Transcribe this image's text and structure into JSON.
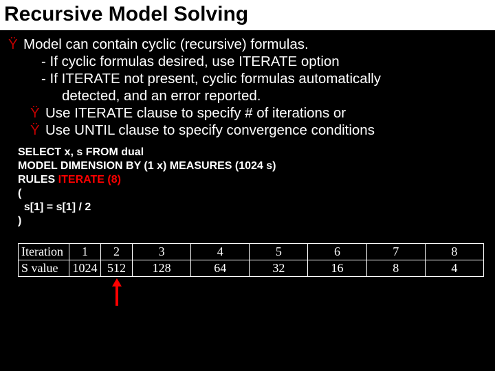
{
  "title": "Recursive Model Solving",
  "bullets": {
    "b1": "Model can contain cyclic (recursive) formulas.",
    "b1a": "- If cyclic formulas desired, use ITERATE option",
    "b1b": "- If ITERATE not present,  cyclic formulas  automatically",
    "b1b2": "detected, and an error reported.",
    "b2": "Use ITERATE clause to specify # of iterations or",
    "b3": "Use UNTIL clause to specify convergence conditions",
    "glyph": "Ÿ"
  },
  "code": {
    "l1": "SELECT x, s FROM dual",
    "l2": "MODEL DIMENSION BY (1 x)   MEASURES (1024 s)",
    "l3a": "RULES ",
    "l3b": "ITERATE (8)",
    "l4": "(",
    "l5": "  s[1] = s[1] / 2",
    "l6": ")"
  },
  "chart_data": {
    "type": "table",
    "rows": [
      {
        "label": "Iteration",
        "values": [
          "1",
          "2",
          "3",
          "4",
          "5",
          "6",
          "7",
          "8"
        ]
      },
      {
        "label": "S value",
        "values": [
          "1024",
          "512",
          "128",
          "64",
          "32",
          "16",
          "8",
          "4"
        ]
      }
    ],
    "arrow_after_column_index": 1
  },
  "table": {
    "r1c0": "Iteration",
    "r1": [
      "1",
      "2",
      "3",
      "4",
      "5",
      "6",
      "7",
      "8"
    ],
    "r2c0": "S value",
    "r2": [
      "1024",
      "512",
      "128",
      "64",
      "32",
      "16",
      "8",
      "4"
    ]
  }
}
